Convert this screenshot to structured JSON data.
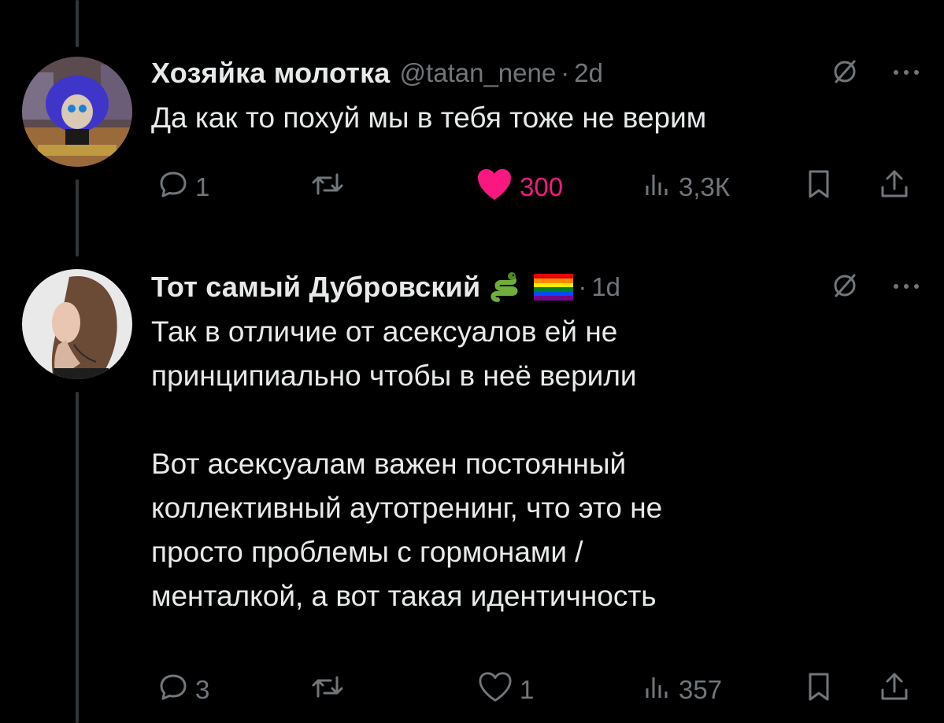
{
  "colors": {
    "background": "#000000",
    "primary_text": "#e7e9ea",
    "secondary_text": "#71767b",
    "like_pink": "#f91880",
    "thread_line": "#333639"
  },
  "tweets": [
    {
      "name": "Хозяйка молотка",
      "handle": "@tatan_nene",
      "sep": "·",
      "time": "2d",
      "text": "Да как то похуй мы в тебя тоже не верим",
      "replies": "1",
      "likes": "300",
      "liked": true,
      "views": "3,3К",
      "icons": [
        "grok-icon",
        "more-icon",
        "reply-icon",
        "retweet-icon",
        "heart-filled-icon",
        "views-icon",
        "bookmark-icon",
        "share-icon"
      ]
    },
    {
      "name": "Тот самый Дубровский",
      "name_emojis": [
        "snake-emoji",
        "rainbow-flag-emoji"
      ],
      "sep": "·",
      "time": "1d",
      "text": "Так в отличие от асексуалов ей не\nпринципиально чтобы в неё верили\n\nВот асексуалам важен постоянный\nколлективный аутотренинг, что это не\nпросто проблемы с гормонами /\nменталкой, а вот такая идентичность",
      "replies": "3",
      "likes": "1",
      "liked": false,
      "views": "357",
      "icons": [
        "grok-icon",
        "more-icon",
        "reply-icon",
        "retweet-icon",
        "heart-icon",
        "views-icon",
        "bookmark-icon",
        "share-icon"
      ]
    }
  ]
}
